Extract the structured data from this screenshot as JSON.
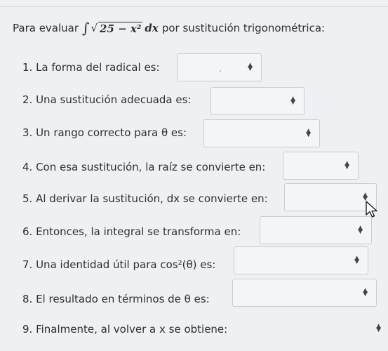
{
  "intro": {
    "prefix": "Para evaluar",
    "integral_sign": "∫",
    "sqrt_sign": "√",
    "radicand": "25 − x²",
    "differential": "dx",
    "suffix": "por sustitución trigonométrica:"
  },
  "questions": [
    {
      "label": "1. La forma del radical es:",
      "value": ""
    },
    {
      "label": "2. Una sustitución adecuada es:",
      "value": ""
    },
    {
      "label": "3. Un rango correcto para θ es:",
      "value": ""
    },
    {
      "label": "4. Con esa sustitución, la raíz se convierte en:",
      "value": ""
    },
    {
      "label": "5. Al derivar la sustitución, dx se convierte en:",
      "value": ""
    },
    {
      "label": "6. Entonces, la integral se transforma en:",
      "value": ""
    },
    {
      "label": "7. Una identidad útil para cos²(θ) es:",
      "value": ""
    },
    {
      "label": "8. El resultado en términos de θ es:",
      "value": ""
    },
    {
      "label": "9. Finalmente, al volver a x se obtiene:",
      "value": ""
    }
  ],
  "icons": {
    "dropdown": "updown-caret-icon",
    "cursor": "mouse-pointer-icon"
  }
}
